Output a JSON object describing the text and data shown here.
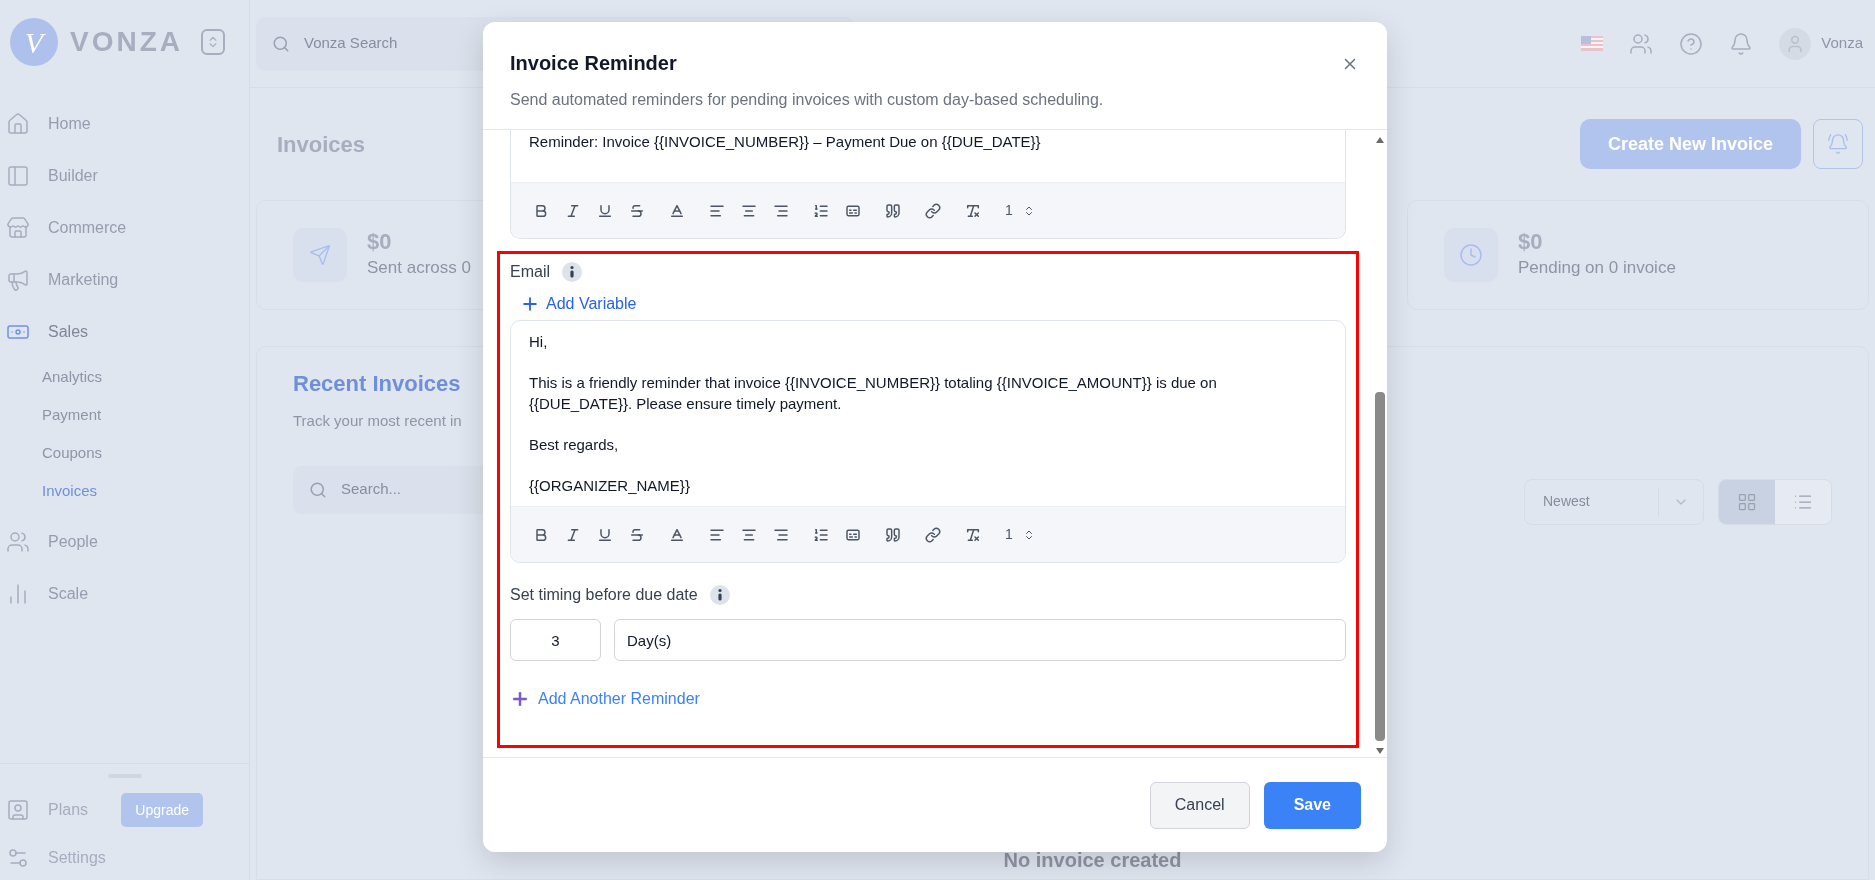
{
  "sidebar": {
    "logo_mark": "V",
    "brand": "VONZA",
    "nav": [
      {
        "label": "Home",
        "selected": false
      },
      {
        "label": "Builder",
        "selected": false
      },
      {
        "label": "Commerce",
        "selected": false
      },
      {
        "label": "Marketing",
        "selected": false
      },
      {
        "label": "Sales",
        "selected": true,
        "children": [
          {
            "label": "Analytics",
            "selected": false
          },
          {
            "label": "Payment",
            "selected": false
          },
          {
            "label": "Coupons",
            "selected": false
          },
          {
            "label": "Invoices",
            "selected": true
          }
        ]
      },
      {
        "label": "People",
        "selected": false
      },
      {
        "label": "Scale",
        "selected": false
      }
    ],
    "plans": {
      "label": "Plans",
      "action": "Upgrade"
    },
    "settings": "Settings"
  },
  "topbar": {
    "search": {
      "placeholder": "Vonza Search"
    },
    "user": "Vonza"
  },
  "page": {
    "title": "Invoices",
    "create_button": "Create New Invoice",
    "stats": [
      {
        "amount": "$0",
        "caption": "Sent across 0"
      },
      {
        "amount": "$0",
        "caption": "Pending on 0 invoice"
      }
    ],
    "recent": {
      "title": "Recent Invoices",
      "subtitle": "Track your most recent in",
      "search": {
        "placeholder": "Search..."
      },
      "sort": "Newest",
      "views": [
        {
          "kind": "grid",
          "selected": true
        },
        {
          "kind": "list",
          "selected": false
        }
      ],
      "empty": "No invoice created"
    }
  },
  "modal": {
    "title": "Invoice Reminder",
    "subtitle": "Send automated reminders for pending invoices with custom day-based scheduling.",
    "subject": {
      "value": "Reminder: Invoice {{INVOICE_NUMBER}} – Payment Due on {{DUE_DATE}}",
      "size": "1"
    },
    "email": {
      "highlighted": true,
      "label": "Email",
      "add_variable": "Add Variable",
      "size": "1",
      "paragraphs": [
        "Hi,",
        "This is a friendly reminder that invoice {{INVOICE_NUMBER}} totaling {{INVOICE_AMOUNT}} is due on {{DUE_DATE}}. Please ensure timely payment.",
        "Best regards,",
        "{{ORGANIZER_NAME}}"
      ]
    },
    "timing": {
      "label": "Set timing before due date",
      "amount": "3",
      "unit": "Day(s)"
    },
    "add_reminder": "Add Another Reminder",
    "buttons": [
      {
        "label": "Cancel",
        "kind": "secondary"
      },
      {
        "label": "Save",
        "kind": "primary"
      }
    ]
  }
}
